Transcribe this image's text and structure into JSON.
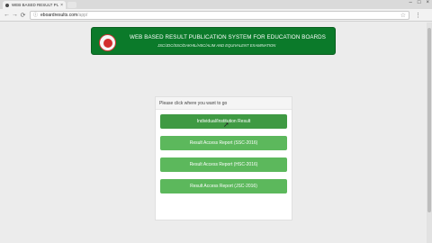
{
  "browser": {
    "tab_title": "WEB BASED RESULT PU",
    "tab_close": "×",
    "window_controls": [
      "–",
      "□",
      "×"
    ],
    "address_host": "eboardresults.com",
    "address_path": "/app/",
    "nav_back": "←",
    "nav_forward": "→",
    "nav_reload": "⟳",
    "star": "☆",
    "menu": "⋮",
    "secure_icon": "ⓘ"
  },
  "header": {
    "title": "WEB BASED RESULT PUBLICATION SYSTEM FOR EDUCATION BOARDS",
    "subtitle": "JSC/JDC/SSC/DAKHIL/HSC/ALIM AND EQUIVALENT EXAMINATION",
    "emblem_icon": "bangladesh-emblem-icon"
  },
  "panel": {
    "prompt": "Please click where you want to go",
    "buttons": [
      "Individual/Institution Result",
      "Result Access Report (SSC-2016)",
      "Result Access Report (HSC-2016)",
      "Result Access Report (JSC-2016)"
    ]
  },
  "colors": {
    "banner_green": "#0b7a2a",
    "button_green": "#5cb85c",
    "button_active": "#3f9a43"
  }
}
